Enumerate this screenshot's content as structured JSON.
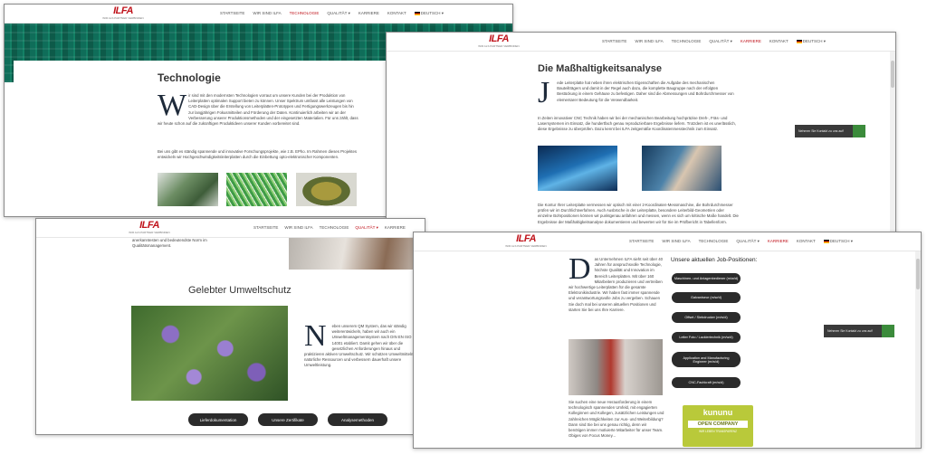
{
  "nav": {
    "logo": "ILFA",
    "logo_sub": "WIR ALS PARTNER VERBINDEN",
    "items": [
      "STARTSEITE",
      "WIR SIND ILFA",
      "TECHNOLOGIE",
      "QUALITÄT",
      "KARRIERE",
      "KONTAKT",
      "DEUTSCH"
    ]
  },
  "shot1": {
    "title": "Technologie",
    "drop": "W",
    "p1": "ir sind mit den modernsten Technologien vorraut um unsere Kunden bei der Produktion von Leiterplatten optimalen Support bieten zu können. Unser Spektrum umfasst alle Leistungen von CAD-Design über die Erstellung von Leiterplatten-Prototypen und Fertigungswerkzeugen bis hin zur langjährigen Fokusmitteilen und Förderung der Daten. Kontinuierlich arbeiten wir an der Verbesserung unserer Produktionsmethoden und der eingesetzten Materialien. Für uns zählt, dass wir heute schon auf die zukünftigen Produktideen unserer Kunden vorbereitet sind.",
    "p2": "Bei uns gibt es ständig spannende und innovative Forschungsprojekte, wie z.B. EPho. Im Rahmen dieses Projektes entwickeln wir Hochgeschwindigkeitsleiterplatten durch die Einbettung opto-elektronischer Komponenten."
  },
  "shot2": {
    "title": "Die Maßhaltigkeitsanalyse",
    "drop": "J",
    "p1": "ede Leiterplatte hat neben ihren elektrischen Eigenschaften die Aufgabe des mechanischen Bauteilträgers und damit in der Regel auch dazu, die komplette Baugruppe nach der erfolgten Bestückung in einem Gehäuse zu befestigen. Daher sind die Abmessungen und Bohrdurchmesser von elementarer Bedeutung für die Verwendbarkeit.",
    "p2": "In Zeiten innovativer CNC Technik haben wir bei der mechanischen Bearbeitung hochpräzise Dreh-, Fräs- und Lasersystemen im Einsatz, die hundertfach genau reproduzierbare Ergebnisse liefern. Trotzdem ist es unerlässlich, diese Ergebnisse zu überprüfen. Dazu kennt bei ILFA zeitgemäße Koordinatenmesstechnik zum Einsatz.",
    "p3": "Die Kontur Ihrer Leiterplatte vermessen wir optisch mit einer 2-Koordinaten-Messmaschine, die Bohrdurchmesser prüfen wir im Durchlichtverfahren. Auch Ausbrüche in der Leiterplatte, besondere Leiterbild-Geometrien oder einzelne Bohrpositionen können wir punktgenau anfahren und messen, wenn es sich um kritische Maße handelt. Die Ergebnisse der Maßhaltigkeitsanalyse dokumentieren und bewerten wir für Sie im Prüfbericht in Tabellenform.",
    "contact": "Nehmen Sie Kontakt zu uns auf!"
  },
  "shot3": {
    "top_text": "anerkanntesten und bedeutendste Norm im Qualitätsmanagement.",
    "title": "Gelebter Umweltschutz",
    "drop": "N",
    "p1": "eben unserem QM System, das wir ständig weiterentwickeln, haben wir auch ein Umweltmanagementsystem nach DIN EN ISO 14001 etabliert. Damit gehen wir über die gesetzlichen Anforderungen hinaus und praktizieren aktiven Umweltschutz. Wir schützen Umweltmitteln natürliche Ressourcen und verbessern dauerhaft unsere Umweltleistung.",
    "buttons": [
      "Lieferdokumentation",
      "Unsere Zertifikate",
      "Analysemethoden"
    ]
  },
  "shot4": {
    "drop": "D",
    "p1": "as Unternehmen ILFA sieht seit über 40 Jahren für anspruchsvolle Technologie, höchste Qualität und Innovation im Bereich Leiterplatten. Mit über 160 Mitarbeitern produzieren und vertreiben wir hochwertige Leiterplatten für die gesamte Elektronikindustrie. Wir haben fast immer spannende und verantwortungsvolle Jobs zu vergeben. Schauen Sie doch mal bei unseren aktuellen Positionen und starten Sie bei uns Ihre Karriere.",
    "p2": "Sie suchen eine neue Herausforderung in einem technologisch spannenden Umfeld, mit engagierten Kolleginnen und Kollegen, zusätzlichen Leistungen und zahlreichen Möglichkeiten zur Aus- und Weiterbildung? Dann sind Sie bei uns genau richtig, denn wir benötigen immer motivierte Mitarbeiter für unser Team. Obiges von Focus Money...",
    "jobs_title": "Unsere aktuellen Job-Positionen:",
    "jobs": [
      "Maschinen- und Anlagenbediener (m/w/d)",
      "Galvaniseur (m/w/d)",
      "Offset / Siebdrucker (m/w/d)",
      "Leiter Foto / Lackiertechnik (m/w/d)",
      "Application and Manufacturing Engineer (m/w/d)",
      "CNC-Fachkraft (m/w/d)"
    ],
    "badge_top": "kununu",
    "badge_mid": "OPEN COMPANY",
    "badge_bottom": "WIR LEBEN TRANSPARENZ",
    "contact": "Nehmen Sie Kontakt zu uns auf!"
  }
}
